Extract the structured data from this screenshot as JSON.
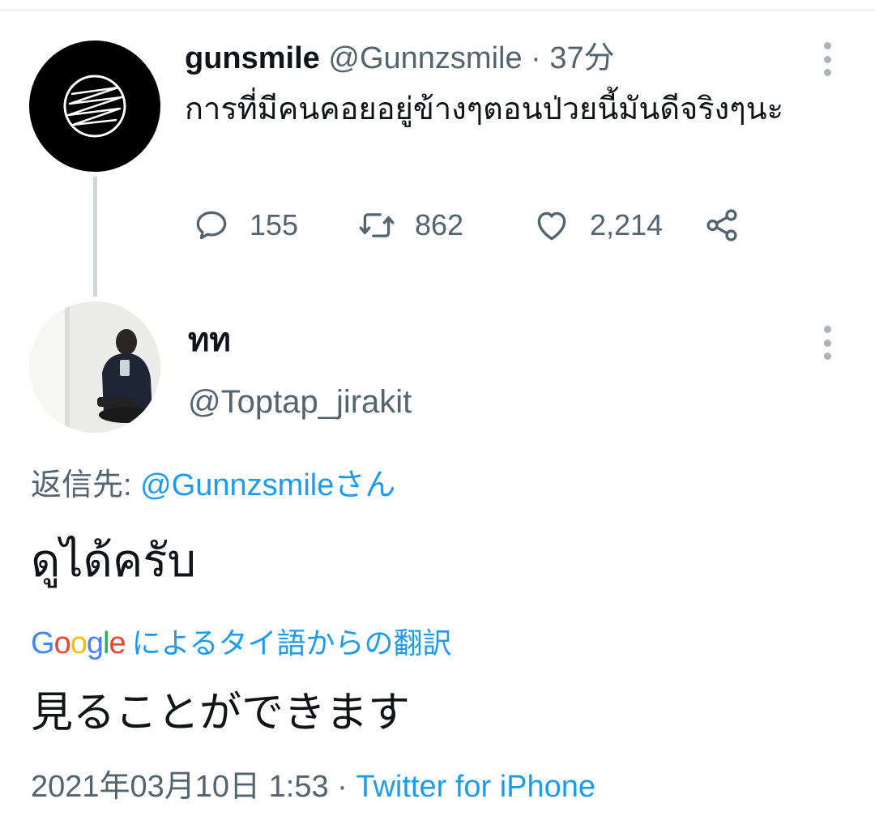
{
  "colors": {
    "accent": "#1d9bf0",
    "secondary_text": "#536471",
    "primary_text": "#0f1419",
    "thread_line": "#cfd9de"
  },
  "parent_tweet": {
    "display_name": "gunsmile",
    "handle": "@Gunnzsmile",
    "separator": " · ",
    "time": "37分",
    "text": "การที่มีคนคอยอยู่ข้างๆตอนป่วยนี้มันดีจริงๆนะ",
    "avatar_icon": "spiral-logo-icon",
    "actions": {
      "reply": {
        "icon": "reply-icon",
        "count": "155"
      },
      "retweet": {
        "icon": "retweet-icon",
        "count": "862"
      },
      "like": {
        "icon": "heart-icon",
        "count": "2,214"
      },
      "share": {
        "icon": "share-icon"
      }
    }
  },
  "reply_tweet": {
    "display_name": "ทท",
    "handle": "@Toptap_jirakit",
    "reply_to_prefix": "返信先: ",
    "reply_to_link": "@Gunnzsmileさん",
    "text": "ดูได้ครับ",
    "translation": {
      "provider": {
        "G": "G",
        "o1": "o",
        "o2": "o",
        "g": "g",
        "l": "l",
        "e": "e"
      },
      "label": "によるタイ語からの翻訳",
      "text": "見ることができます"
    },
    "timestamp": "2021年03月10日 1:53",
    "separator": " · ",
    "client": "Twitter for iPhone"
  }
}
